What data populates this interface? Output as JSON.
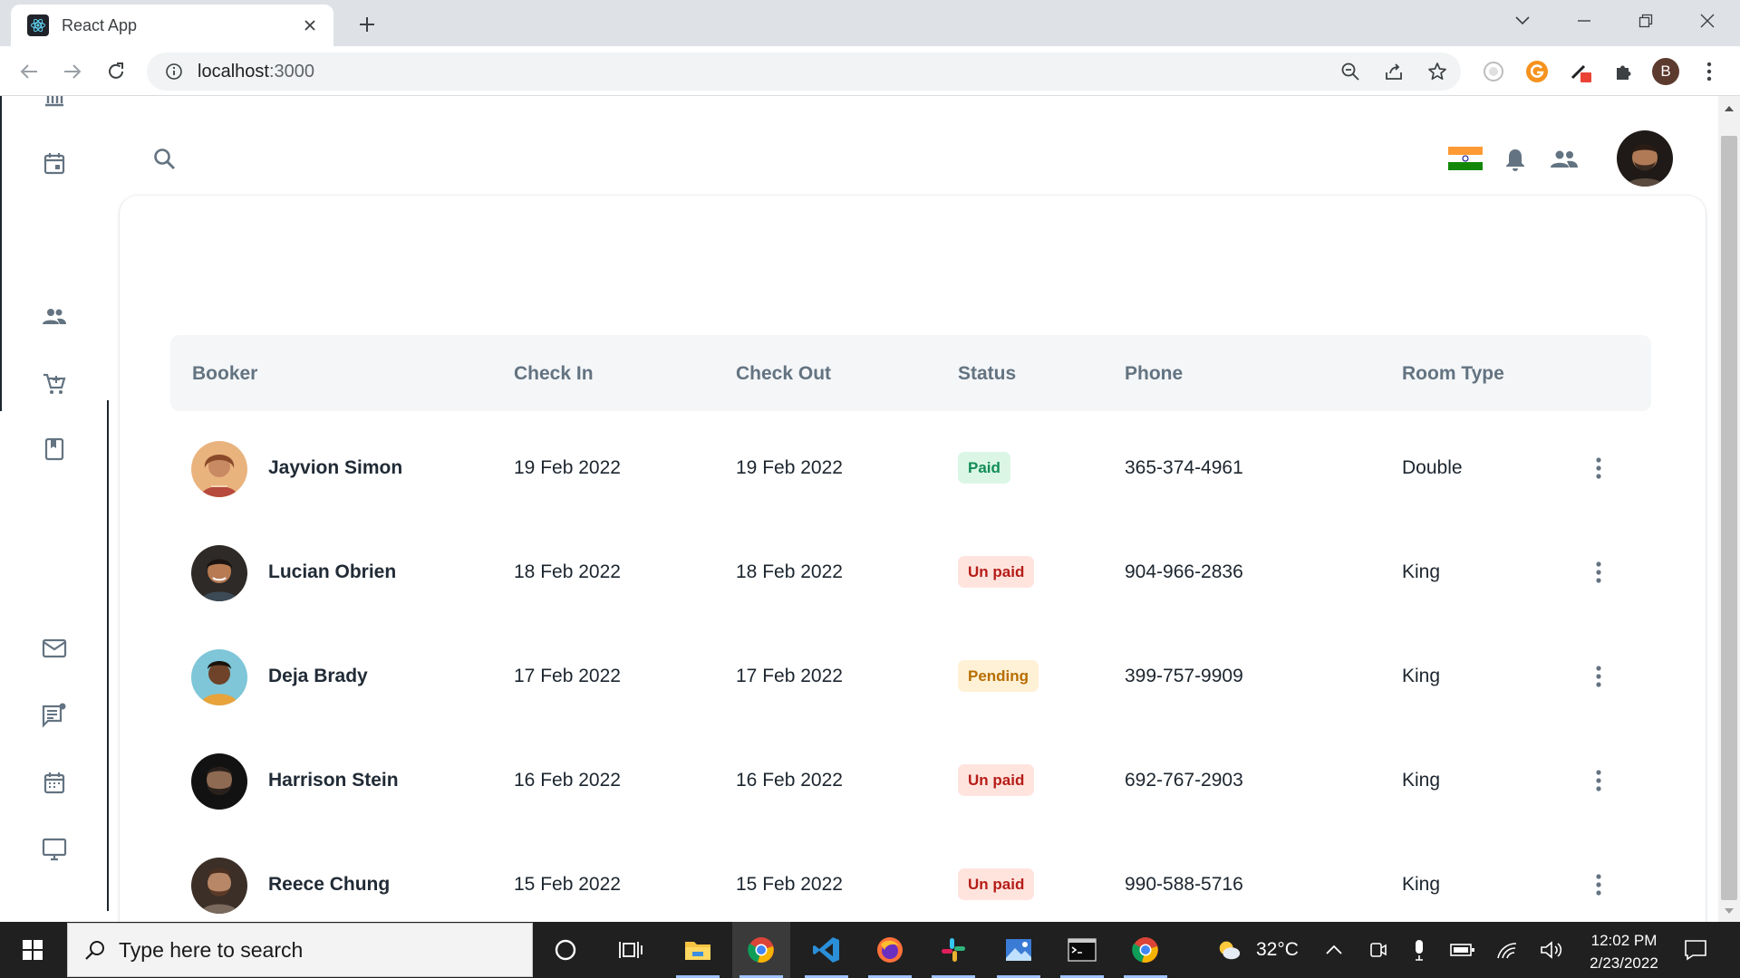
{
  "browser": {
    "tab_title": "React App",
    "url_host": "localhost",
    "url_port": ":3000",
    "profile_initial": "B"
  },
  "table": {
    "columns": [
      "Booker",
      "Check In",
      "Check Out",
      "Status",
      "Phone",
      "Room Type"
    ],
    "rows": [
      {
        "name": "Jayvion Simon",
        "check_in": "19 Feb 2022",
        "check_out": "19 Feb 2022",
        "status": "Paid",
        "phone": "365-374-4961",
        "room_type": "Double"
      },
      {
        "name": "Lucian Obrien",
        "check_in": "18 Feb 2022",
        "check_out": "18 Feb 2022",
        "status": "Un paid",
        "phone": "904-966-2836",
        "room_type": "King"
      },
      {
        "name": "Deja Brady",
        "check_in": "17 Feb 2022",
        "check_out": "17 Feb 2022",
        "status": "Pending",
        "phone": "399-757-9909",
        "room_type": "King"
      },
      {
        "name": "Harrison Stein",
        "check_in": "16 Feb 2022",
        "check_out": "16 Feb 2022",
        "status": "Un paid",
        "phone": "692-767-2903",
        "room_type": "King"
      },
      {
        "name": "Reece Chung",
        "check_in": "15 Feb 2022",
        "check_out": "15 Feb 2022",
        "status": "Un paid",
        "phone": "990-588-5716",
        "room_type": "King"
      }
    ]
  },
  "status_colors": {
    "Paid": {
      "bg": "#dbf6e5",
      "fg": "#118d57"
    },
    "Un paid": {
      "bg": "#ffe4de",
      "fg": "#b71d18"
    },
    "Pending": {
      "bg": "#fff1d6",
      "fg": "#b76e00"
    }
  },
  "icons": {
    "sidebar": [
      "dashboard-icon",
      "calendar-icon",
      "users-icon",
      "cart-icon",
      "book-icon",
      "mail-icon",
      "chat-icon",
      "calendar-icon",
      "monitor-icon"
    ],
    "header": [
      "search-icon",
      "india-flag-icon",
      "bell-icon",
      "contacts-icon",
      "avatar"
    ]
  },
  "taskbar": {
    "search_placeholder": "Type here to search",
    "temperature": "32°C",
    "time": "12:02 PM",
    "date": "2/23/2022"
  }
}
